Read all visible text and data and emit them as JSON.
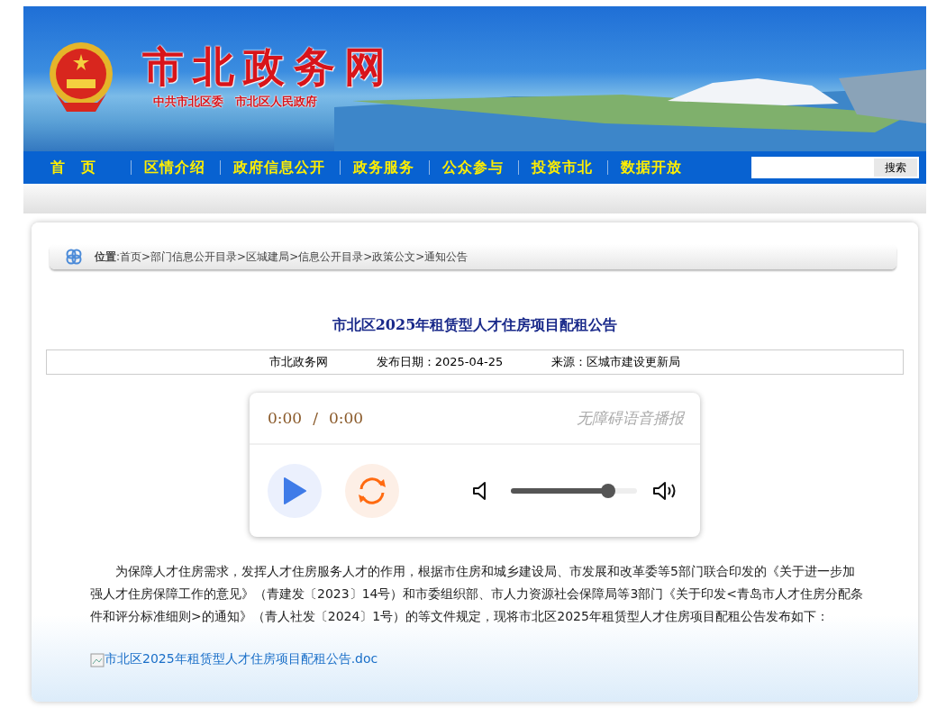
{
  "header": {
    "site_title": "市北政务网",
    "subtitle": "中共市北区委　市北区人民政府"
  },
  "nav": {
    "items": [
      {
        "label": "首　页"
      },
      {
        "label": "区情介绍"
      },
      {
        "label": "政府信息公开"
      },
      {
        "label": "政务服务"
      },
      {
        "label": "公众参与"
      },
      {
        "label": "投资市北"
      },
      {
        "label": "数据开放"
      }
    ],
    "search_button": "搜索"
  },
  "breadcrumb": {
    "label": "位置",
    "separator": ":",
    "items": [
      "首页",
      "部门信息公开目录",
      "区城建局",
      "信息公开目录",
      "政策公文",
      "通知公告"
    ],
    "arrow": ">"
  },
  "article": {
    "title": "市北区2025年租赁型人才住房项目配租公告",
    "meta": [
      "市北政务网",
      "发布日期：2025-04-25",
      "来源：区城市建设更新局"
    ]
  },
  "player": {
    "current": "0:00",
    "divider": "/",
    "total": "0:00",
    "caption": "无障碍语音播报",
    "volume": {
      "level": 0.77
    }
  },
  "body": {
    "paragraph": "为保障人才住房需求，发挥人才住房服务人才的作用，根据市住房和城乡建设局、市发展和改革委等5部门联合印发的《关于进一步加强人才住房保障工作的意见》（青建发〔2023〕14号）和市委组织部、市人力资源社会保障局等3部门《关于印发<青岛市人才住房分配条件和评分标准细则>的通知》（青人社发〔2024〕1号）的等文件规定，现将市北区2025年租赁型人才住房项目配租公告发布如下：",
    "attachment": "市北区2025年租赁型人才住房项目配租公告.doc"
  }
}
